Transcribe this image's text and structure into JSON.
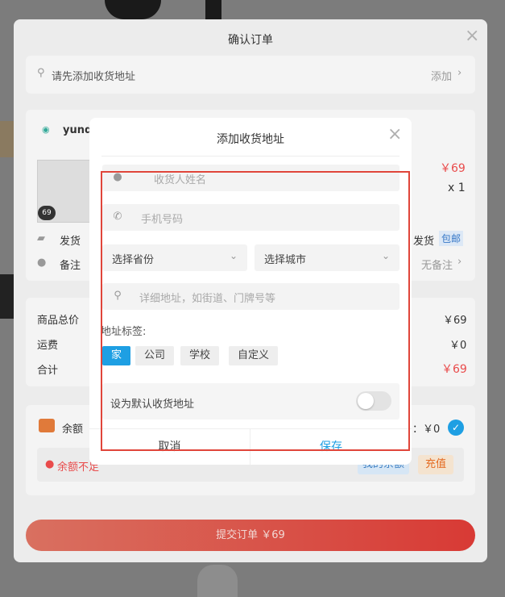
{
  "outer": {
    "title": "确认订单",
    "address_prompt": "请先添加收货地址",
    "add_label": "添加",
    "store_name": "yund",
    "item_price": "￥69",
    "item_qty": "x 1",
    "thumb_badge": "69",
    "delivery_label": "发货",
    "delivery_right": "发货",
    "free_shipping": "包邮",
    "remark_label": "备注",
    "remark_right": "无备注",
    "goods_total_label": "商品总价",
    "goods_total_value": "￥69",
    "shipping_label": "运费",
    "shipping_value": "￥0",
    "total_label": "合计",
    "total_value": "￥69",
    "balance_label": "余额",
    "balance_value": "：￥0",
    "balance_warning": "余额不足",
    "my_balance": "我的余额",
    "recharge": "充值",
    "submit": "提交订单   ￥69"
  },
  "modal": {
    "title": "添加收货地址",
    "name_placeholder": "收货人姓名",
    "phone_placeholder": "手机号码",
    "province": "选择省份",
    "city": "选择城市",
    "address_placeholder": "详细地址，如街道、门牌号等",
    "tags_label": "地址标签:",
    "tags": [
      "家",
      "公司",
      "学校",
      "自定义"
    ],
    "default_label": "设为默认收货地址",
    "default_enabled": false,
    "cancel": "取消",
    "save": "保存"
  },
  "colors": {
    "accent": "#1e9fe3",
    "price_red": "#e94b4b",
    "highlight_box": "#e0453a"
  }
}
